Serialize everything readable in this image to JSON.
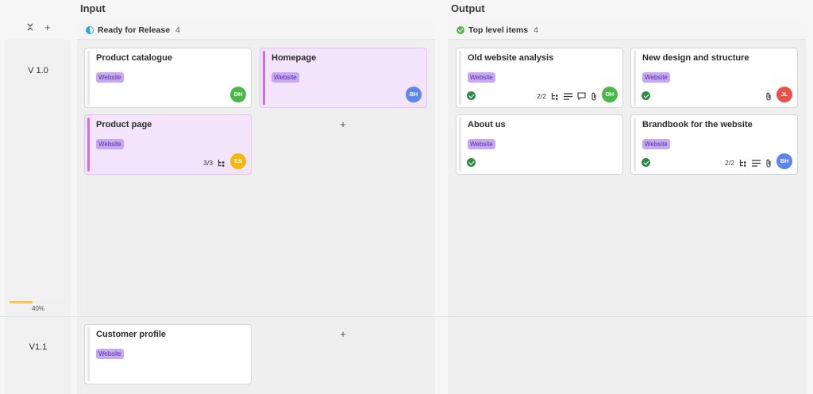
{
  "sections": {
    "input": "Input",
    "output": "Output"
  },
  "rail": {
    "collapse_icon": "collapse-icon",
    "add_icon": "plus-icon",
    "versions": [
      {
        "label": "V 1.0",
        "progress_text": "40%",
        "progress": 0.4
      },
      {
        "label": "V1.1"
      }
    ]
  },
  "columns": [
    {
      "title": "Ready for Release",
      "count": "4",
      "status_icon": "in-progress-icon",
      "status_color": "#23a7e0"
    },
    {
      "title": "Top level items",
      "count": "4",
      "status_icon": "done-check-icon",
      "status_color": "#59b94a"
    }
  ],
  "cards": {
    "product_catalogue": {
      "title": "Product catalogue",
      "tag": "Website",
      "avatar": "DH",
      "avatar_color": "#4cb84c"
    },
    "homepage": {
      "title": "Homepage",
      "tag": "Website",
      "avatar": "BH",
      "avatar_color": "#5b86f0"
    },
    "product_page": {
      "title": "Product page",
      "tag": "Website",
      "subtasks": "3/3",
      "avatar": "ES",
      "avatar_color": "#f2b80b"
    },
    "old_website": {
      "title": "Old website analysis",
      "tag": "Website",
      "subtasks": "2/2",
      "avatar": "DH",
      "avatar_color": "#4cb84c"
    },
    "new_design": {
      "title": "New design and structure",
      "tag": "Website",
      "avatar": "JL",
      "avatar_color": "#e8524a"
    },
    "about_us": {
      "title": "About us",
      "tag": "Website"
    },
    "brandbook": {
      "title": "Brandbook for the website",
      "tag": "Website",
      "subtasks": "2/2",
      "avatar": "BH",
      "avatar_color": "#5b86f0"
    },
    "customer_profile": {
      "title": "Customer profile",
      "tag": "Website"
    }
  },
  "colors": {
    "tag_bg": "#c7a9f2",
    "pink_card": "#f4e4fb",
    "accent_stripe": "#c572e0"
  }
}
